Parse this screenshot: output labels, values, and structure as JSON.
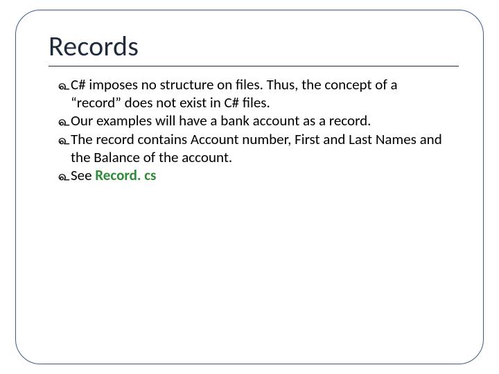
{
  "slide": {
    "title": "Records",
    "bullets": [
      {
        "text": "C# imposes no structure on files. Thus, the concept of a “record” does not exist in C# files."
      },
      {
        "text": "Our examples will have a bank account as a record."
      },
      {
        "text": "The record contains Account number, First and Last Names and the Balance of the account."
      },
      {
        "prefix": "See ",
        "link": "Record. cs"
      }
    ]
  }
}
